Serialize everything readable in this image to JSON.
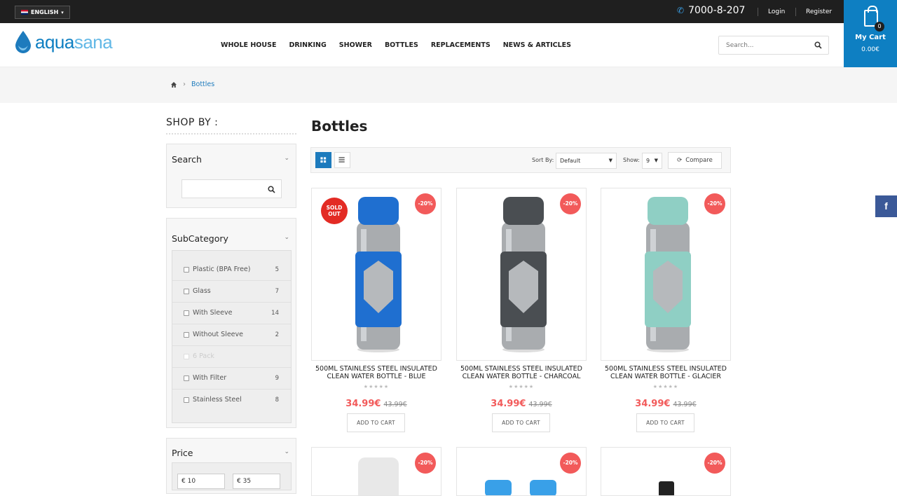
{
  "topbar": {
    "language": "ENGLISH",
    "phone": "7000-8-207",
    "login": "Login",
    "register": "Register"
  },
  "cart": {
    "label": "My Cart",
    "total": "0.00€",
    "count": "0"
  },
  "brand": {
    "name_a": "aqua",
    "name_b": "sana",
    "color": "#0e7fc2"
  },
  "nav": [
    "WHOLE HOUSE",
    "DRINKING",
    "SHOWER",
    "BOTTLES",
    "REPLACEMENTS",
    "NEWS & ARTICLES"
  ],
  "header_search": {
    "placeholder": "Search..."
  },
  "breadcrumb": {
    "current": "Bottles"
  },
  "sidebar": {
    "heading": "SHOP BY :",
    "search_title": "Search",
    "subcategory_title": "SubCategory",
    "subcategories": [
      {
        "label": "Plastic (BPA Free)",
        "count": "5"
      },
      {
        "label": "Glass",
        "count": "7"
      },
      {
        "label": "With Sleeve",
        "count": "14"
      },
      {
        "label": "Without Sleeve",
        "count": "2"
      },
      {
        "label": "6 Pack",
        "count": ""
      },
      {
        "label": "With Filter",
        "count": "9"
      },
      {
        "label": "Stainless Steel",
        "count": "8"
      }
    ],
    "price_title": "Price",
    "price_min": "€ 10",
    "price_max": "€ 35"
  },
  "main": {
    "title": "Bottles",
    "sort_label": "Sort By:",
    "sort_value": "Default",
    "show_label": "Show:",
    "show_value": "9",
    "compare_label": "Compare"
  },
  "products": [
    {
      "name": "500ML STAINLESS STEEL INSULATED CLEAN WATER BOTTLE - BLUE",
      "price": "34.99€",
      "old_price": "43.99€",
      "discount": "-20%",
      "sold_out": "SOLD OUT",
      "color": "#1f6fd0",
      "add_label": "ADD TO CART",
      "stars": "★★★★★"
    },
    {
      "name": "500ML STAINLESS STEEL INSULATED CLEAN WATER BOTTLE - CHARCOAL",
      "price": "34.99€",
      "old_price": "43.99€",
      "discount": "-20%",
      "sold_out": "",
      "color": "#4a4e52",
      "add_label": "ADD TO CART",
      "stars": "★★★★★"
    },
    {
      "name": "500ML STAINLESS STEEL INSULATED CLEAN WATER BOTTLE - GLACIER",
      "price": "34.99€",
      "old_price": "43.99€",
      "discount": "-20%",
      "sold_out": "",
      "color": "#8fcfc4",
      "add_label": "ADD TO CART",
      "stars": "★★★★★"
    },
    {
      "discount": "-20%",
      "color": "#e8e8e8"
    },
    {
      "discount": "-20%",
      "color": "#39a0e8"
    },
    {
      "discount": "-20%",
      "color": "#222222"
    }
  ],
  "social": {
    "facebook": "f"
  }
}
